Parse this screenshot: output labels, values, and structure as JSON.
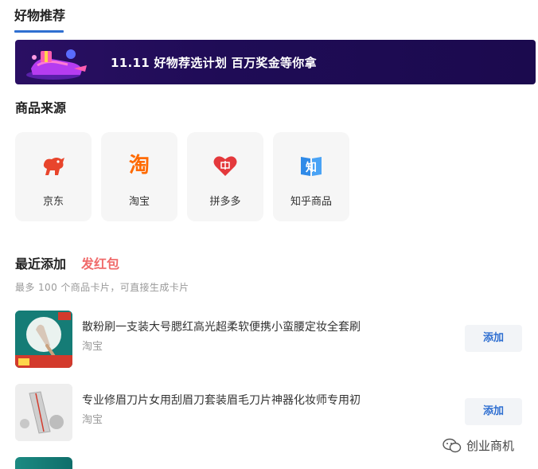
{
  "tabs": {
    "active_label": "好物推荐"
  },
  "banner": {
    "text": "11.11 好物荐选计划 百万奖金等你拿"
  },
  "sources": {
    "title": "商品来源",
    "items": [
      {
        "label": "京东",
        "icon": "jd-dog-icon"
      },
      {
        "label": "淘宝",
        "icon": "taobao-icon",
        "glyph": "淘"
      },
      {
        "label": "拼多多",
        "icon": "pinduoduo-heart-icon"
      },
      {
        "label": "知乎商品",
        "icon": "zhihu-book-icon",
        "glyph": "知"
      }
    ]
  },
  "recent": {
    "title": "最近添加",
    "badge": "发红包",
    "hint": "最多 100 个商品卡片，可直接生成卡片",
    "items": [
      {
        "title": "散粉刷一支装大号腮红高光超柔软便携小蛮腰定妆全套刷",
        "source": "淘宝",
        "action": "添加"
      },
      {
        "title": "专业修眉刀片女用刮眉刀套装眉毛刀片神器化妆师专用初",
        "source": "淘宝",
        "action": "添加"
      }
    ]
  },
  "watermark": {
    "text": "创业商机"
  },
  "colors": {
    "accent": "#2f6fd1",
    "badge": "#f06a6a",
    "banner_bg": "#1f0c56"
  }
}
